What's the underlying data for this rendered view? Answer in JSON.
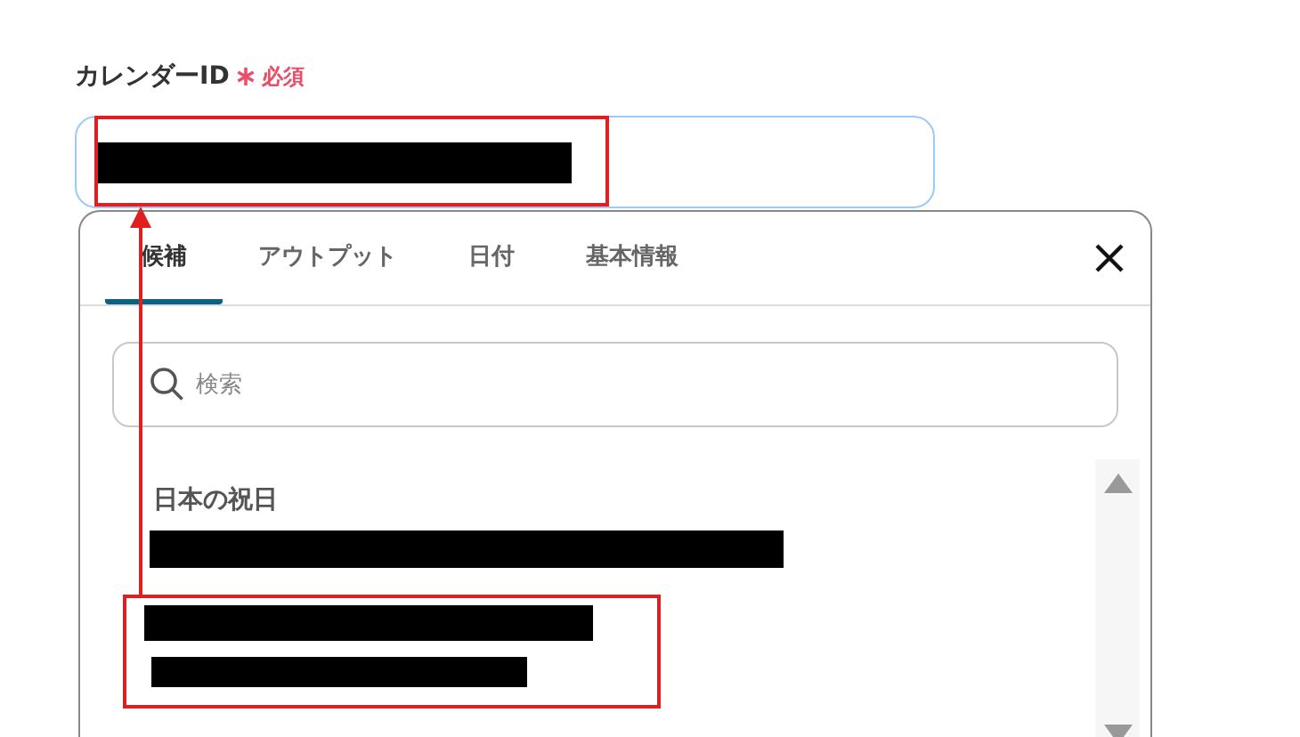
{
  "field": {
    "label": "カレンダーID",
    "required": "必須"
  },
  "picker": {
    "tabs": [
      {
        "label": "候補",
        "selected": true
      },
      {
        "label": "アウトプット",
        "selected": false
      },
      {
        "label": "日付",
        "selected": false
      },
      {
        "label": "基本情報",
        "selected": false
      }
    ],
    "search": {
      "placeholder": "検索"
    },
    "group": {
      "title": "日本の祝日"
    }
  }
}
